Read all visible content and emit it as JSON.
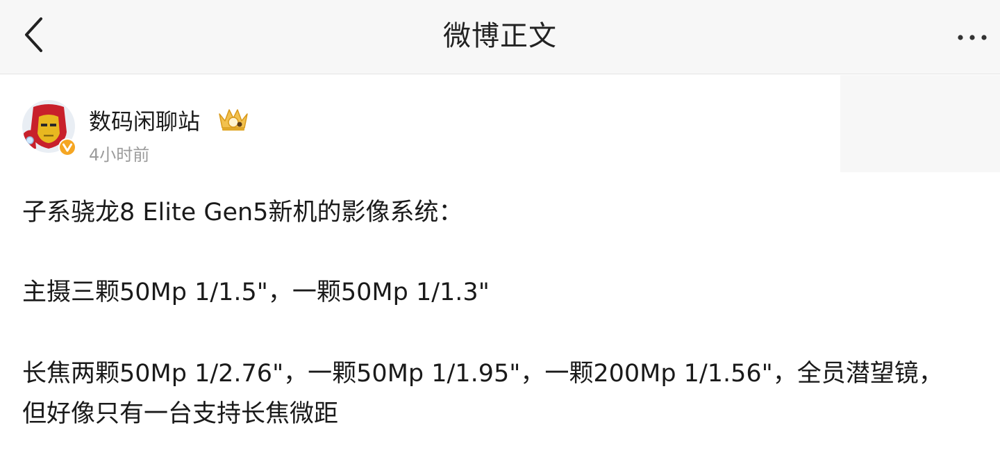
{
  "nav": {
    "title": "微博正文",
    "back_icon": "chevron-left-icon",
    "more_icon": "more-dots-icon"
  },
  "author": {
    "name": "数码闲聊站",
    "time": "4小时前",
    "verified_icon": "verified-v-icon",
    "crown_icon": "crown-icon",
    "avatar": "iron-man-avatar"
  },
  "post": {
    "line1": "子系骁龙8 Elite Gen5新机的影像系统：",
    "line2": "主摄三颗50Mp 1/1.5\"，一颗50Mp 1/1.3\"",
    "line3a": "长焦两颗50Mp 1/2.76\"，一颗50Mp 1/1.95\"，一颗200Mp 1/1.56\"，全员潜望镜，",
    "line3b": "但好像只有一台支持长焦微距"
  },
  "colors": {
    "navbar_bg": "#f7f7f7",
    "text_primary": "#1a1a1a",
    "text_secondary": "#9b9b9b",
    "verified_orange": "#f5a623",
    "avatar_red": "#c8202b",
    "avatar_gold": "#e8b820"
  }
}
